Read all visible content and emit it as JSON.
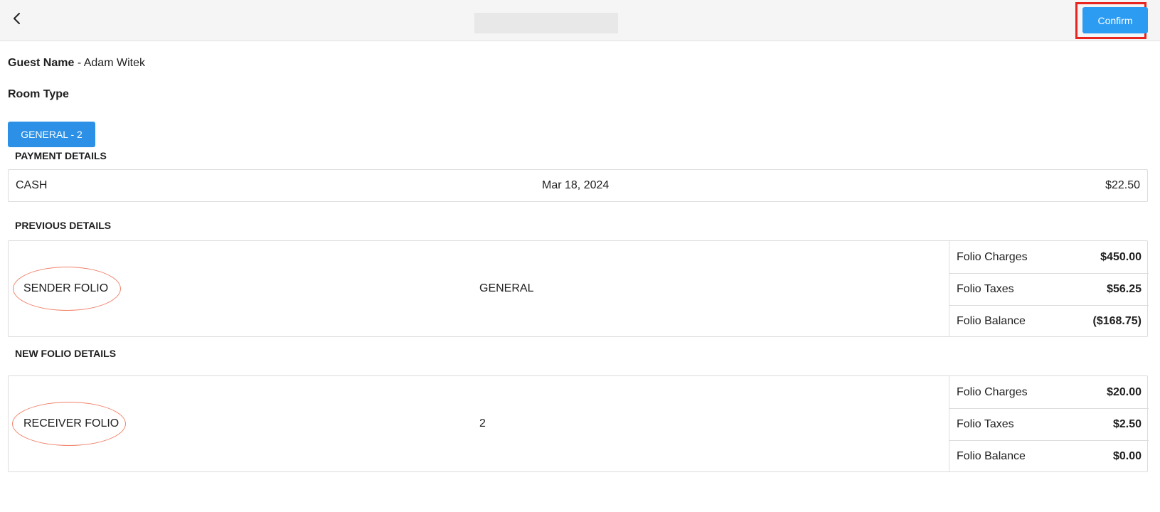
{
  "header": {
    "title": "",
    "confirm_label": "Confirm"
  },
  "guest": {
    "label": "Guest Name",
    "value": "- Adam Witek"
  },
  "room": {
    "label": "Room Type",
    "value": ""
  },
  "folio_tab": {
    "label": "GENERAL - 2"
  },
  "payment_details": {
    "title": "PAYMENT DETAILS",
    "method": "CASH",
    "date": "Mar 18, 2024",
    "amount": "$22.50"
  },
  "previous_details": {
    "title": "PREVIOUS DETAILS",
    "folio_label": "SENDER FOLIO",
    "folio_name": "GENERAL",
    "rows": [
      {
        "label": "Folio Charges",
        "value": "$450.00"
      },
      {
        "label": "Folio Taxes",
        "value": "$56.25"
      },
      {
        "label": "Folio Balance",
        "value": "($168.75)"
      }
    ]
  },
  "new_folio_details": {
    "title": "NEW FOLIO DETAILS",
    "folio_label": "RECEIVER FOLIO",
    "folio_name": "2",
    "rows": [
      {
        "label": "Folio Charges",
        "value": "$20.00"
      },
      {
        "label": "Folio Taxes",
        "value": "$2.50"
      },
      {
        "label": "Folio Balance",
        "value": "$0.00"
      }
    ]
  },
  "colors": {
    "primary": "#2b9cf2",
    "highlight": "#e8251f",
    "annotation": "#f0826b"
  }
}
